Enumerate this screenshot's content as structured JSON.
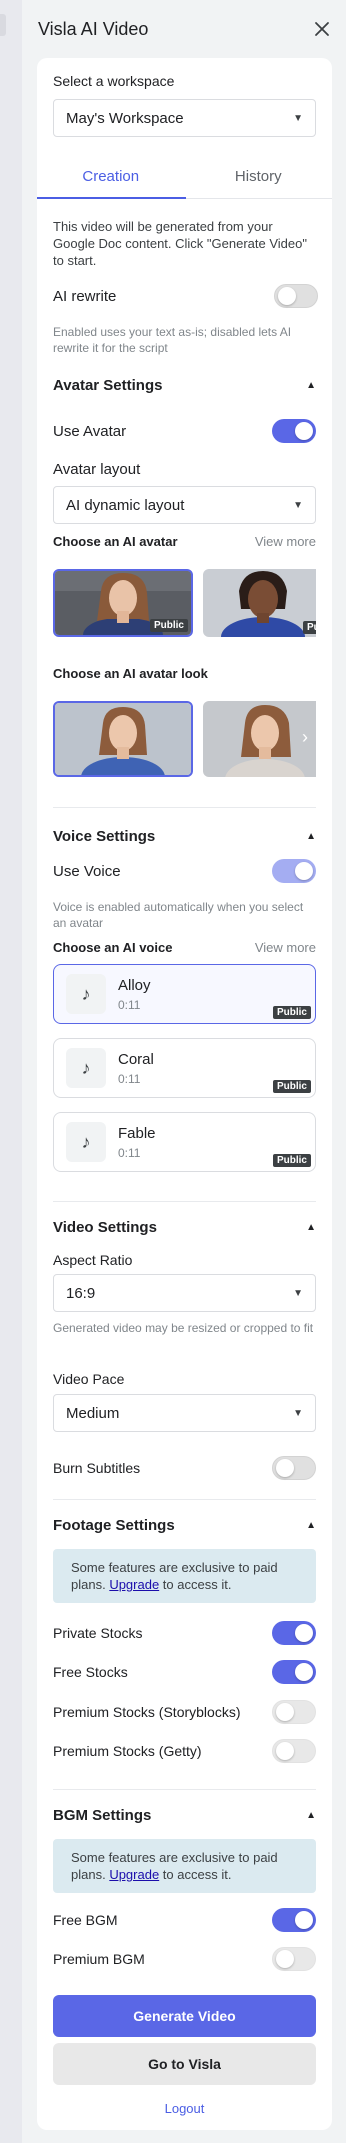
{
  "header": {
    "title": "Visla AI Video"
  },
  "workspace": {
    "label": "Select a workspace",
    "value": "May's Workspace"
  },
  "tabs": [
    {
      "label": "Creation"
    },
    {
      "label": "History"
    }
  ],
  "intro": "This video will be generated from your Google Doc content. Click \"Generate Video\" to start.",
  "ai_rewrite": {
    "label": "AI rewrite",
    "enabled": false,
    "help": "Enabled uses your text as-is; disabled lets AI rewrite it for the script"
  },
  "avatar_settings": {
    "title": "Avatar Settings",
    "use_avatar": {
      "label": "Use Avatar",
      "enabled": true
    },
    "layout": {
      "label": "Avatar layout",
      "value": "AI dynamic layout"
    },
    "choose_avatar": {
      "label": "Choose an AI avatar",
      "view_more": "View more",
      "badge": "Public",
      "badge_partial": "Pu"
    },
    "choose_look": {
      "label": "Choose an AI avatar look",
      "next": "›"
    }
  },
  "voice_settings": {
    "title": "Voice Settings",
    "use_voice": {
      "label": "Use Voice",
      "enabled": true
    },
    "help": "Voice is enabled automatically when you select an avatar",
    "choose_voice": {
      "label": "Choose an AI voice",
      "view_more": "View more"
    },
    "voices": [
      {
        "name": "Alloy",
        "duration": "0:11",
        "badge": "Public",
        "selected": true
      },
      {
        "name": "Coral",
        "duration": "0:11",
        "badge": "Public",
        "selected": false
      },
      {
        "name": "Fable",
        "duration": "0:11",
        "badge": "Public",
        "selected": false
      }
    ]
  },
  "video_settings": {
    "title": "Video Settings",
    "aspect_ratio": {
      "label": "Aspect Ratio",
      "value": "16:9",
      "help": "Generated video may be resized or cropped to fit"
    },
    "video_pace": {
      "label": "Video Pace",
      "value": "Medium"
    },
    "burn_subtitles": {
      "label": "Burn Subtitles",
      "enabled": false
    }
  },
  "footage_settings": {
    "title": "Footage Settings",
    "notice_pre": "Some features are exclusive to paid plans. ",
    "notice_link": "Upgrade",
    "notice_post": " to access it.",
    "private_stocks": {
      "label": "Private Stocks",
      "enabled": true
    },
    "free_stocks": {
      "label": "Free Stocks",
      "enabled": true
    },
    "premium_storyblocks": {
      "label": "Premium Stocks (Storyblocks)",
      "enabled": false
    },
    "premium_getty": {
      "label": "Premium Stocks (Getty)",
      "enabled": false
    }
  },
  "bgm_settings": {
    "title": "BGM Settings",
    "notice_pre": "Some features are exclusive to paid plans. ",
    "notice_link": "Upgrade",
    "notice_post": " to access it.",
    "free_bgm": {
      "label": "Free BGM",
      "enabled": true
    },
    "premium_bgm": {
      "label": "Premium BGM",
      "enabled": false
    }
  },
  "actions": {
    "generate": "Generate Video",
    "go_to_visla": "Go to Visla",
    "logout": "Logout"
  },
  "colors": {
    "accent": "#5a67e6",
    "tab_active": "#4b5ee4",
    "notice_bg": "#dbeaf0",
    "badge_bg": "#3c4043"
  },
  "icons": {
    "close": "close-icon",
    "music": "music-note-icon",
    "caret": "caret-down-icon",
    "collapse": "collapse-triangle-icon"
  }
}
